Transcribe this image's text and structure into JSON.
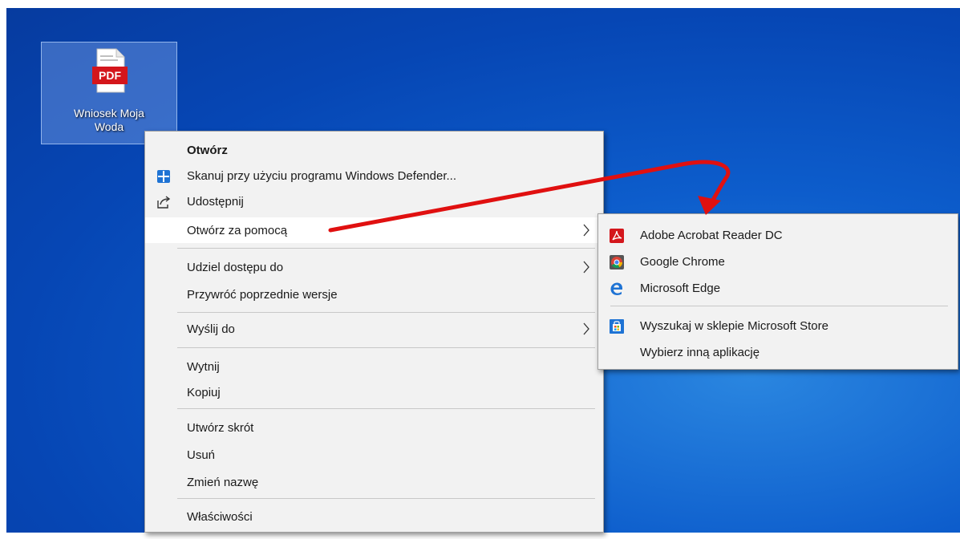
{
  "desktop": {
    "file": {
      "label_line1": "Wniosek Moja",
      "label_line2": "Woda",
      "badge": "PDF",
      "icon": "pdf-file-icon"
    }
  },
  "context_menu": {
    "items": [
      {
        "label": "Otwórz",
        "bold": true
      },
      {
        "label": "Skanuj przy użyciu programu Windows Defender...",
        "icon": "windows-defender-icon"
      },
      {
        "label": "Udostępnij",
        "icon": "share-icon"
      },
      {
        "label": "Otwórz za pomocą",
        "submenu": true,
        "highlighted": true
      },
      {
        "label": "Udziel dostępu do",
        "submenu": true
      },
      {
        "label": "Przywróć poprzednie wersje"
      },
      {
        "label": "Wyślij do",
        "submenu": true
      },
      {
        "label": "Wytnij"
      },
      {
        "label": "Kopiuj"
      },
      {
        "label": "Utwórz skrót"
      },
      {
        "label": "Usuń"
      },
      {
        "label": "Zmień nazwę"
      },
      {
        "label": "Właściwości"
      }
    ]
  },
  "open_with_submenu": {
    "items": [
      {
        "label": "Adobe Acrobat Reader DC",
        "icon": "adobe-acrobat-icon"
      },
      {
        "label": "Google Chrome",
        "icon": "chrome-icon"
      },
      {
        "label": "Microsoft Edge",
        "icon": "edge-icon"
      },
      {
        "label": "Wyszukaj w sklepie Microsoft Store",
        "icon": "microsoft-store-icon"
      },
      {
        "label": "Wybierz inną aplikację"
      }
    ]
  },
  "colors": {
    "desktop_blue": "#0d5dcc",
    "annotation_arrow": "#e01010",
    "menu_bg": "#f2f2f2"
  }
}
